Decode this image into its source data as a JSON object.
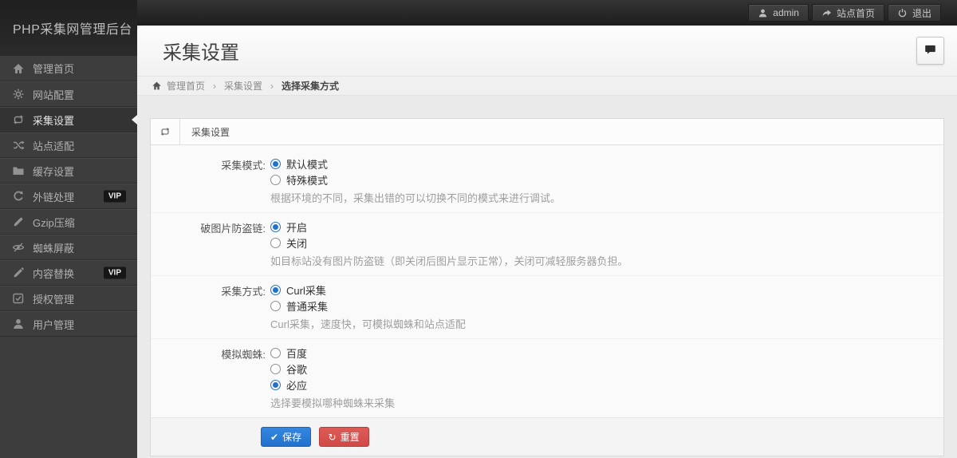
{
  "topbar": {
    "logo": "PHP采集网管理后台",
    "user_button": "admin",
    "site_home_button": "站点首页",
    "logout_button": "退出"
  },
  "sidebar": {
    "items": [
      {
        "label": "管理首页",
        "icon": "home",
        "active": false,
        "badge": ""
      },
      {
        "label": "网站配置",
        "icon": "gear",
        "active": false,
        "badge": ""
      },
      {
        "label": "采集设置",
        "icon": "repeat",
        "active": true,
        "badge": ""
      },
      {
        "label": "站点适配",
        "icon": "shuffle",
        "active": false,
        "badge": ""
      },
      {
        "label": "缓存设置",
        "icon": "folder",
        "active": false,
        "badge": ""
      },
      {
        "label": "外链处理",
        "icon": "refresh",
        "active": false,
        "badge": "VIP"
      },
      {
        "label": "Gzip压缩",
        "icon": "brush",
        "active": false,
        "badge": ""
      },
      {
        "label": "蜘蛛屏蔽",
        "icon": "eye-off",
        "active": false,
        "badge": ""
      },
      {
        "label": "内容替换",
        "icon": "pencil",
        "active": false,
        "badge": "VIP"
      },
      {
        "label": "授权管理",
        "icon": "check-square",
        "active": false,
        "badge": ""
      },
      {
        "label": "用户管理",
        "icon": "user",
        "active": false,
        "badge": ""
      }
    ]
  },
  "header": {
    "title": "采集设置"
  },
  "breadcrumb": {
    "separator": "›",
    "items": [
      "管理首页",
      "采集设置",
      "选择采集方式"
    ]
  },
  "panel": {
    "title": "采集设置",
    "rows": [
      {
        "label": "采集模式:",
        "options": [
          {
            "text": "默认模式",
            "checked": true
          },
          {
            "text": "特殊模式",
            "checked": false
          }
        ],
        "help": "根据环境的不同，采集出错的可以切换不同的模式来进行调试。"
      },
      {
        "label": "破图片防盗链:",
        "options": [
          {
            "text": "开启",
            "checked": true
          },
          {
            "text": "关闭",
            "checked": false
          }
        ],
        "help": "如目标站没有图片防盗链（即关闭后图片显示正常），关闭可减轻服务器负担。"
      },
      {
        "label": "采集方式:",
        "options": [
          {
            "text": "Curl采集",
            "checked": true
          },
          {
            "text": "普通采集",
            "checked": false
          }
        ],
        "help": "Curl采集，速度快，可模拟蜘蛛和站点适配"
      },
      {
        "label": "模拟蜘蛛:",
        "options": [
          {
            "text": "百度",
            "checked": false
          },
          {
            "text": "谷歌",
            "checked": false
          },
          {
            "text": "必应",
            "checked": true
          }
        ],
        "help": "选择要模拟哪种蜘蛛来采集"
      }
    ],
    "save_label": "保存",
    "save_icon_glyph": "✔",
    "reset_label": "重置",
    "reset_icon_glyph": "↻"
  },
  "colors": {
    "accent_blue": "#2272cd",
    "danger_red": "#d04a46"
  }
}
